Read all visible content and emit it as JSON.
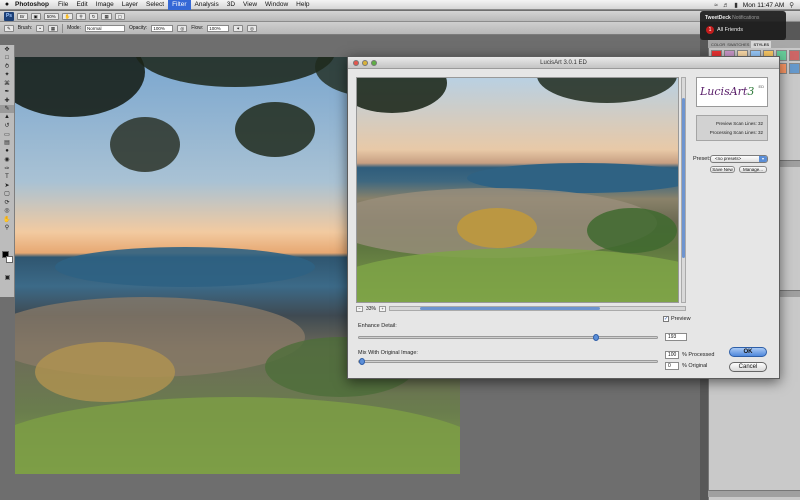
{
  "menubar": {
    "app_name": "Photoshop",
    "items": [
      "File",
      "Edit",
      "Image",
      "Layer",
      "Select",
      "Filter",
      "Analysis",
      "3D",
      "View",
      "Window",
      "Help"
    ],
    "active_item": "Filter",
    "clock": "Mon 11:47 AM"
  },
  "appbar": {
    "logo": "Ps",
    "br_label": "Br",
    "zoom": "50%"
  },
  "options": {
    "brush_label": "Brush:",
    "mode_label": "Mode:",
    "mode_value": "Normal",
    "opacity_label": "Opacity:",
    "opacity_value": "100%",
    "flow_label": "Flow:",
    "flow_value": "100%"
  },
  "notification": {
    "app": "TweetDeck",
    "subtitle": "Notifications",
    "count": "1",
    "message": "All Friends"
  },
  "panels": {
    "tabs": [
      "COLOR",
      "SWATCHES",
      "STYLES"
    ],
    "active_tab": "STYLES"
  },
  "dialog": {
    "title": "LucisArt 3.0.1 ED",
    "zoom": "33%",
    "preview_label": "Preview",
    "preview_checked": true,
    "enhance_label": "Enhance Detail:",
    "enhance_value": "193",
    "enhance_level": 0.8,
    "mix_label": "Mix With Original Image:",
    "mix_processed_value": "100",
    "mix_processed_label": "% Processed",
    "mix_original_value": "0",
    "mix_original_label": "% Original",
    "mix_level": 0.0,
    "logo_text": "LucisArt",
    "logo_num": "3",
    "logo_ed": "ED",
    "preview_scan_label": "Preview Scan Lines:",
    "preview_scan_value": "32",
    "processing_scan_label": "Processing Scan Lines:",
    "processing_scan_value": "32",
    "preset_label": "Preset:",
    "preset_value": "<no presets>",
    "save_new_label": "Save New",
    "manage_label": "Manage...",
    "ok_label": "OK",
    "cancel_label": "Cancel"
  },
  "icons": {
    "apple": "apple-icon",
    "wifi": "wifi-icon",
    "search": "spotlight-icon"
  }
}
